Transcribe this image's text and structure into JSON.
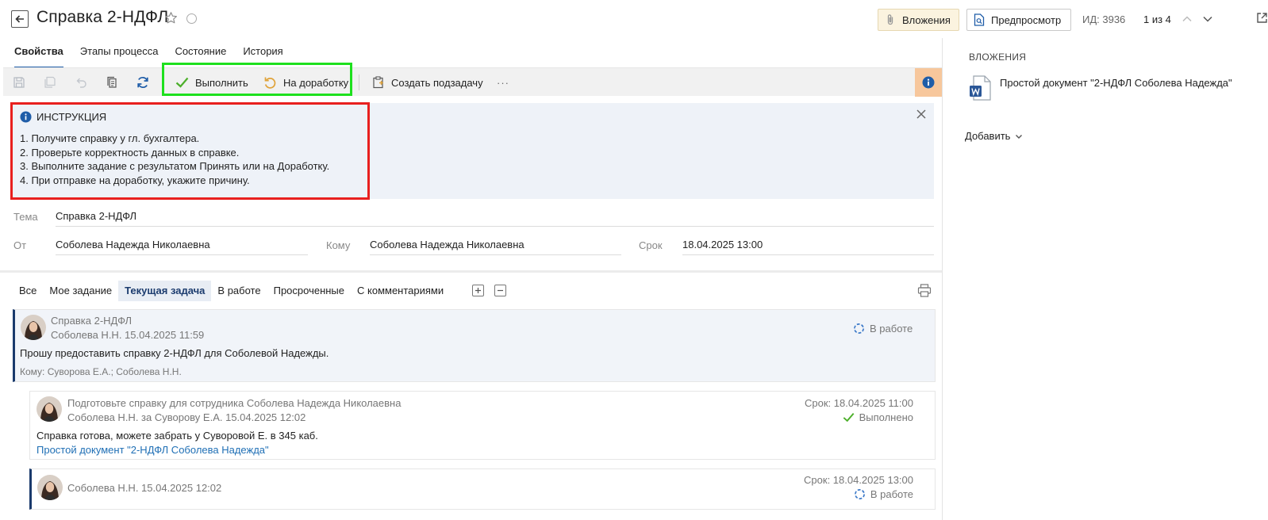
{
  "header": {
    "title": "Справка 2-НДФЛ",
    "attachments_label": "Вложения",
    "preview_label": "Предпросмотр",
    "id_text": "ИД: 3936",
    "counter_text": "1 из 4"
  },
  "tabs": [
    "Свойства",
    "Этапы процесса",
    "Состояние",
    "История"
  ],
  "toolbar": {
    "complete_label": "Выполнить",
    "rework_label": "На доработку",
    "subtask_label": "Создать подзадачу",
    "more_label": "···"
  },
  "instruction": {
    "title": "ИНСТРУКЦИЯ",
    "lines": [
      "1. Получите справку у гл. бухгалтера.",
      "2. Проверьте корректность данных в справке.",
      "3. Выполните задание с результатом Принять или на Доработку.",
      "4. При отправке на доработку, укажите причину."
    ]
  },
  "fields": {
    "topic_label": "Тема",
    "topic_value": "Справка 2-НДФЛ",
    "from_label": "От",
    "from_value": "Соболева Надежда Николаевна",
    "to_label": "Кому",
    "to_value": "Соболева Надежда Николаевна",
    "deadline_label": "Срок",
    "deadline_value": "18.04.2025 13:00"
  },
  "filters": [
    "Все",
    "Мое задание",
    "Текущая задача",
    "В работе",
    "Просроченные",
    "С комментариями"
  ],
  "thread": [
    {
      "title": "Справка 2-НДФЛ",
      "author_date": "Соболева Н.Н.  15.04.2025 11:59",
      "status": "В работе",
      "body": "Прошу предоставить справку 2-НДФЛ для Соболевой Надежды.",
      "recipients": "Кому: Суворова Е.А.; Соболева Н.Н."
    },
    {
      "title": "Подготовьте справку для сотрудника Соболева Надежда Николаевна",
      "author_date": "Соболева Н.Н. за Суворову Е.А.  15.04.2025 12:02",
      "deadline": "Срок: 18.04.2025 11:00",
      "status": "Выполнено",
      "body": "Справка готова, можете забрать у Суворовой Е. в 345 каб.",
      "link": "Простой документ \"2-НДФЛ Соболева Надежда\""
    },
    {
      "author_date": "Соболева Н.Н.  15.04.2025 12:02",
      "deadline": "Срок: 18.04.2025 13:00",
      "status": "В работе"
    }
  ],
  "attachments_panel": {
    "title": "ВЛОЖЕНИЯ",
    "doc_name": "Простой документ \"2-НДФЛ Соболева Надежда\"",
    "add_label": "Добавить"
  },
  "colors": {
    "accent": "#1f5da8",
    "highlight_green": "#1ee01e",
    "highlight_red": "#e8201f",
    "info_orange": "#f7c79c",
    "done_green": "#4caf2a"
  }
}
